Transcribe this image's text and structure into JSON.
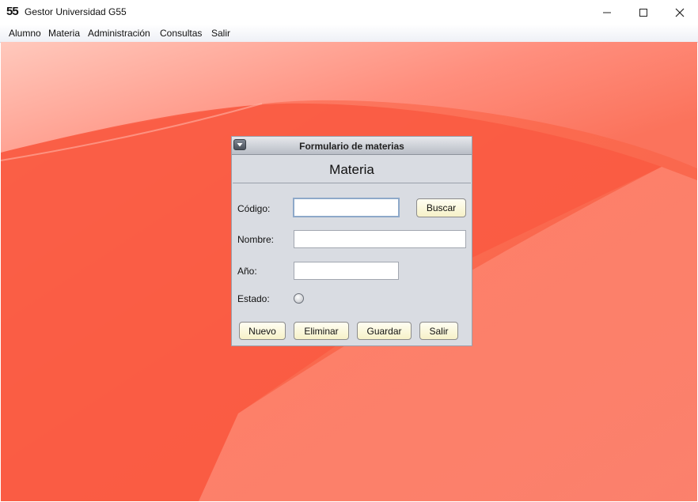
{
  "window": {
    "icon_text": "55",
    "title": "Gestor Universidad G55"
  },
  "menubar": {
    "items": [
      "Alumno",
      "Materia",
      "Administración",
      "Consultas",
      "Salir"
    ]
  },
  "desktop": {
    "background_color": "#fb6a4f"
  },
  "form": {
    "window_title": "Formulario de materias",
    "heading": "Materia",
    "codigo_label": "Código:",
    "codigo_value": "",
    "buscar_label": "Buscar",
    "nombre_label": "Nombre:",
    "nombre_value": "",
    "anio_label": "Año:",
    "anio_value": "",
    "estado_label": "Estado:",
    "estado_selected": false,
    "buttons": {
      "nuevo": "Nuevo",
      "eliminar": "Eliminar",
      "guardar": "Guardar",
      "salir": "Salir"
    },
    "button_color": "#fbf6d6"
  }
}
